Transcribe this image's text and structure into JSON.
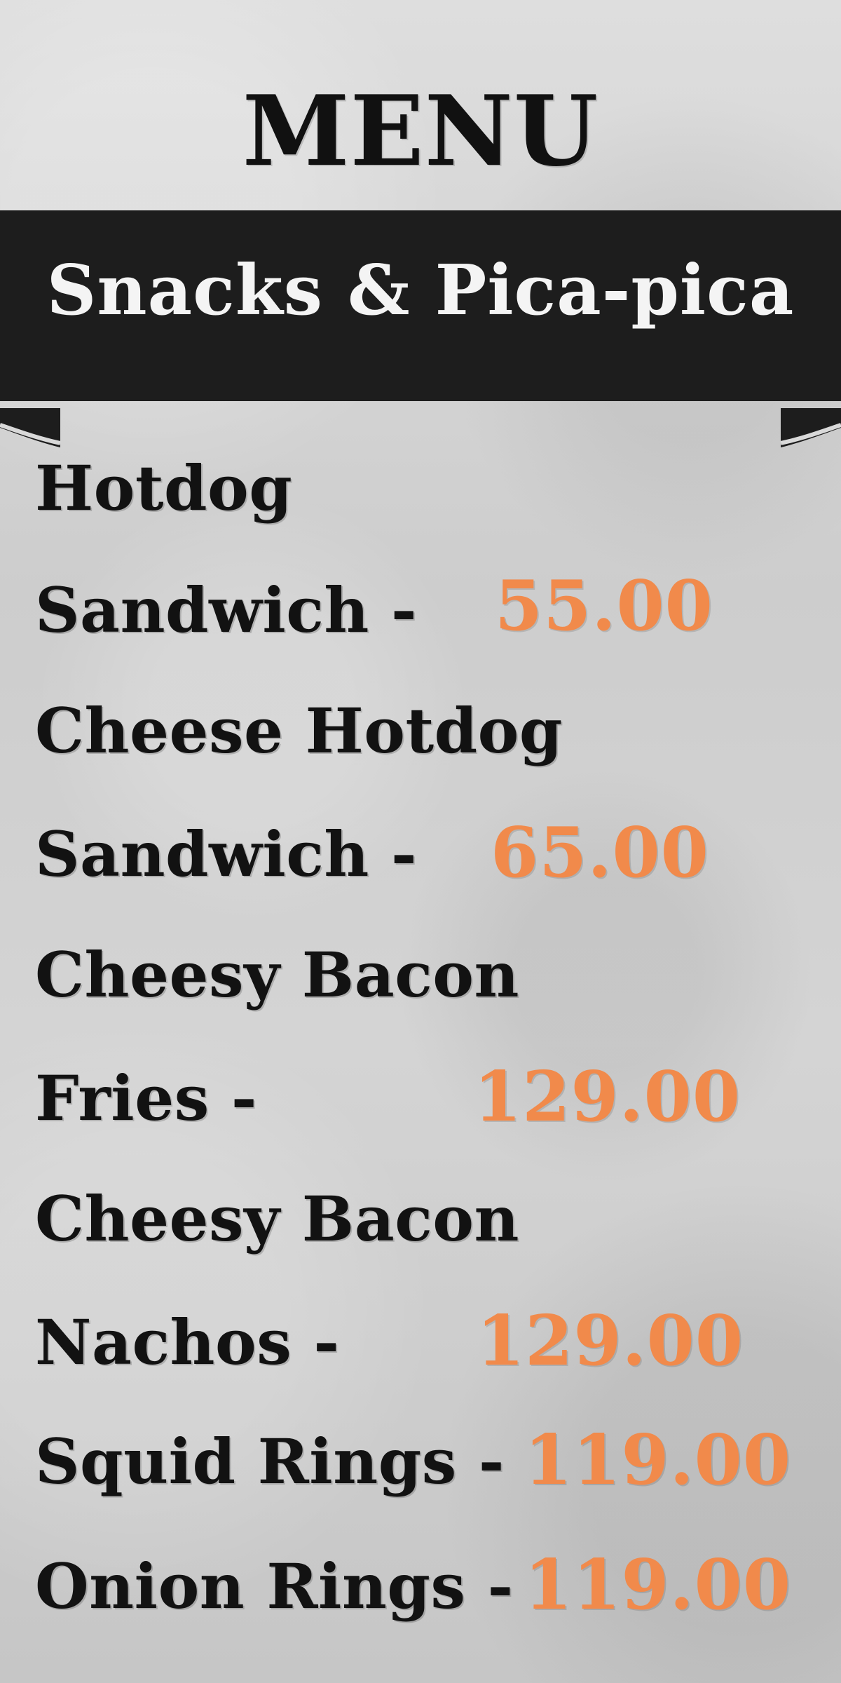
{
  "header": {
    "title": "MENU",
    "section_title": "Snacks & Pica-pica"
  },
  "menu": {
    "items": [
      {
        "line1": "Hotdog",
        "line2": "Sandwich -",
        "price": "55.00"
      },
      {
        "line1": "Cheese Hotdog",
        "line2": "Sandwich -",
        "price": "65.00"
      },
      {
        "line1": "Cheesy Bacon",
        "line2": "Fries -",
        "price": "129.00"
      },
      {
        "line1": "Cheesy Bacon",
        "line2": "Nachos -",
        "price": "129.00"
      },
      {
        "line1": "Squid Rings -",
        "price": "119.00"
      },
      {
        "line1": "Onion Rings -",
        "price": "119.00"
      }
    ]
  },
  "colors": {
    "background": "#cfcfcf",
    "text": "#121212",
    "price": "#f18a4b",
    "banner": "#1d1d1d",
    "banner_text": "#f4f4f4"
  }
}
